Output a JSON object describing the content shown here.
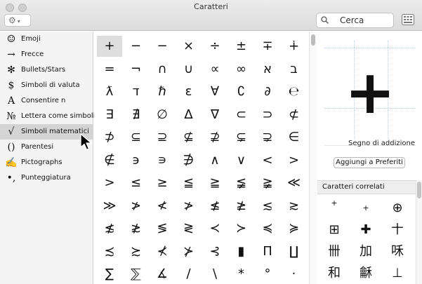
{
  "window": {
    "title": "Caratteri"
  },
  "toolbar": {
    "action_glyph": "⚙",
    "action_caret": "▾",
    "search_placeholder": "Cerca"
  },
  "sidebar": {
    "items": [
      {
        "icon": "☺",
        "label": "Emoji",
        "selected": false
      },
      {
        "icon": "→",
        "label": "Frecce",
        "selected": false
      },
      {
        "icon": "✻",
        "label": "Bullets/Stars",
        "selected": false
      },
      {
        "icon": "$",
        "label": "Simboli di valuta",
        "selected": false
      },
      {
        "icon": "A",
        "label": "Consentire n",
        "selected": false
      },
      {
        "icon": "№",
        "label": "Lettera come simboli",
        "selected": false
      },
      {
        "icon": "√",
        "label": "Simboli matematici",
        "selected": true
      },
      {
        "icon": "()",
        "label": "Parentesi",
        "selected": false
      },
      {
        "icon": "✍",
        "label": "Pictographs",
        "selected": false
      },
      {
        "icon": "•,",
        "label": "Punteggiatura",
        "selected": false
      }
    ]
  },
  "grid": {
    "rows": [
      [
        "+",
        "−",
        "−",
        "×",
        "÷",
        "±",
        "∓",
        "∔"
      ],
      [
        "=",
        "¬",
        "∩",
        "∪",
        "∝",
        "∞",
        "א",
        "ב"
      ],
      [
        "ƛ",
        "ד",
        "ℏ",
        "ε",
        "∀",
        "∁",
        "∂",
        "℮"
      ],
      [
        "∃",
        "∄",
        "∅",
        "∆",
        "∇",
        "⊂",
        "⊃",
        "⊄"
      ],
      [
        "⊅",
        "⊆",
        "⊇",
        "⊈",
        "⊉",
        "⊊",
        "⊋",
        "∈"
      ],
      [
        "∉",
        "϶",
        "∍",
        "∌",
        "∧",
        "∨",
        "<",
        ">"
      ],
      [
        ">",
        "≤",
        "≥",
        "≦",
        "≧",
        "≨",
        "≩",
        "≪"
      ],
      [
        "≫",
        "≯",
        "≮",
        "≯",
        "≰",
        "≱",
        "≲",
        "≳"
      ],
      [
        "≴",
        "≵",
        "≶",
        "≷",
        "≺",
        "≻",
        "≼",
        "≽"
      ],
      [
        "≾",
        "≿",
        "⊀",
        "⊁",
        "⊰",
        "▮",
        "Π",
        "∐"
      ],
      [
        "∑",
        "⅀",
        "∡",
        "/",
        "\\",
        "*",
        "°",
        "·"
      ]
    ],
    "selected": [
      0,
      0
    ]
  },
  "detail": {
    "preview_char": "+",
    "char_name": "Segno di addizione",
    "fav_button": "Aggiungi a Preferiti"
  },
  "related": {
    "header": "Caratteri correlati",
    "chars": [
      "+",
      "+",
      "⊕",
      "⊞",
      "✚",
      "〸",
      "卌",
      "加",
      "咊",
      "和",
      "龢",
      "⊥"
    ]
  }
}
